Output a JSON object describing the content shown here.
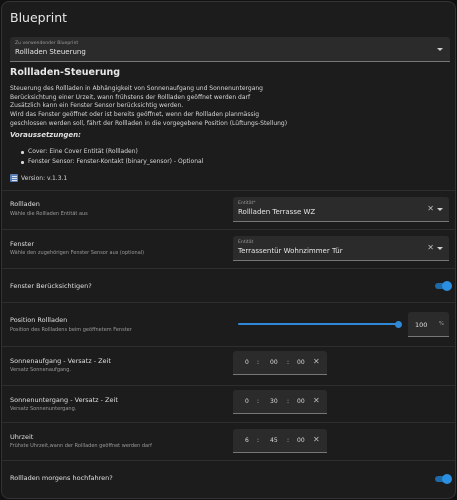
{
  "header": {
    "title": "Blueprint"
  },
  "blueprint_select": {
    "label": "Zu verwendender Blueprint",
    "value": "Rollladen Steuerung"
  },
  "intro": {
    "heading": "Rollladen-Steuerung",
    "lines": [
      "Steuerung des Rollladen in Abhängigkeit von Sonnenaufgang und Sonnenuntergang",
      "Berücksichtung einer Urzeit, wann frühstens der Rollladen geöffnet werden darf",
      "Zusätzlich kann ein Fenster Sensor berücksichtig werden.",
      "Wird das Fenster geöffnet oder ist bereits geöffnet, wenn der Rollladen planmässig",
      "geschlossen werden soll, fährt der Rollladen in die vorgegebene Position (Lüftungs-Stellung)"
    ],
    "requirements_heading": "Voraussetzungen:",
    "requirements": [
      "Cover: Eine Cover Entität (Rollladen)",
      "Fenster Sensor: Fenster-Kontakt (binary_sensor) - Optional"
    ],
    "version": "Version: v.1.3.1"
  },
  "fields": {
    "rollladen": {
      "label": "Rollladen",
      "desc": "Wähle die Rollladen Entität aus",
      "input_label": "Entität*",
      "value": "Rollladen Terrasse WZ"
    },
    "fenster": {
      "label": "Fenster",
      "desc": "Wähle den zugehörigen Fenster Sensor aus (optional)",
      "input_label": "Entität",
      "value": "Terrassentür Wohnzimmer Tür"
    },
    "fenster_beruecksichtigen": {
      "label": "Fenster Berücksichtigen?",
      "on": true
    },
    "position": {
      "label": "Position Rollladen",
      "desc": "Position des Rollladens beim geöffnetem Fenster",
      "value": "100",
      "unit": "%",
      "level": 1.0
    },
    "sonnenaufgang": {
      "label": "Sonnenaufgang - Versatz - Zeit",
      "desc": "Versatz Sonnenaufgang.",
      "h": "0",
      "m": "00",
      "s": "00"
    },
    "sonnenuntergang": {
      "label": "Sonnenuntergang - Versatz - Zeit",
      "desc": "Versatz Sonnenuntergang.",
      "h": "0",
      "m": "30",
      "s": "00"
    },
    "uhrzeit": {
      "label": "Uhrzeit",
      "desc": "Frühste Uhrzeit,wann der Rollladen geöffnet werden darf",
      "h": "6",
      "m": "45",
      "s": "00"
    },
    "morgens": {
      "label": "Rollladen morgens hochfahren?",
      "on": true
    }
  },
  "time_separator": ":",
  "clear_glyph": "✕",
  "colors": {
    "accent": "#2f88d6",
    "card": "#1c1c1c",
    "input": "#2b2b2b"
  }
}
